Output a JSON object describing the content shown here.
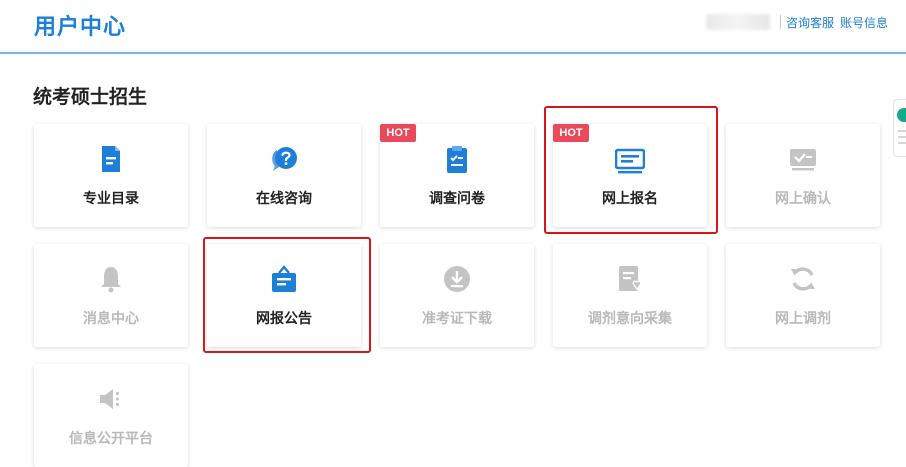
{
  "header": {
    "title": "用户中心",
    "links": [
      "咨询客服",
      "账号信息"
    ]
  },
  "section": {
    "title": "统考硕士招生"
  },
  "cards": [
    {
      "label": "专业目录",
      "icon": "catalog-icon",
      "hot": false,
      "enabled": true
    },
    {
      "label": "在线咨询",
      "icon": "chat-question-icon",
      "hot": false,
      "enabled": true
    },
    {
      "label": "调查问卷",
      "icon": "questionnaire-clipboard-icon",
      "hot": true,
      "enabled": true
    },
    {
      "label": "网上报名",
      "icon": "online-registration-icon",
      "hot": true,
      "enabled": true
    },
    {
      "label": "网上确认",
      "icon": "confirm-icon",
      "hot": false,
      "enabled": false
    },
    {
      "label": "消息中心",
      "icon": "bell-icon",
      "hot": false,
      "enabled": false
    },
    {
      "label": "网报公告",
      "icon": "announcement-icon",
      "hot": false,
      "enabled": true
    },
    {
      "label": "准考证下载",
      "icon": "download-icon",
      "hot": false,
      "enabled": false
    },
    {
      "label": "调剂意向采集",
      "icon": "intent-form-icon",
      "hot": false,
      "enabled": false
    },
    {
      "label": "网上调剂",
      "icon": "refresh-icon",
      "hot": false,
      "enabled": false
    },
    {
      "label": "信息公开平台",
      "icon": "speaker-icon",
      "hot": false,
      "enabled": false
    }
  ],
  "badge": {
    "hot_label": "HOT"
  },
  "colors": {
    "brand": "#1e7fd9",
    "icon_active": "#1e7fd9",
    "icon_disabled": "#bfbfbf",
    "hot": "#e9495a",
    "highlight": "#d6161d"
  }
}
